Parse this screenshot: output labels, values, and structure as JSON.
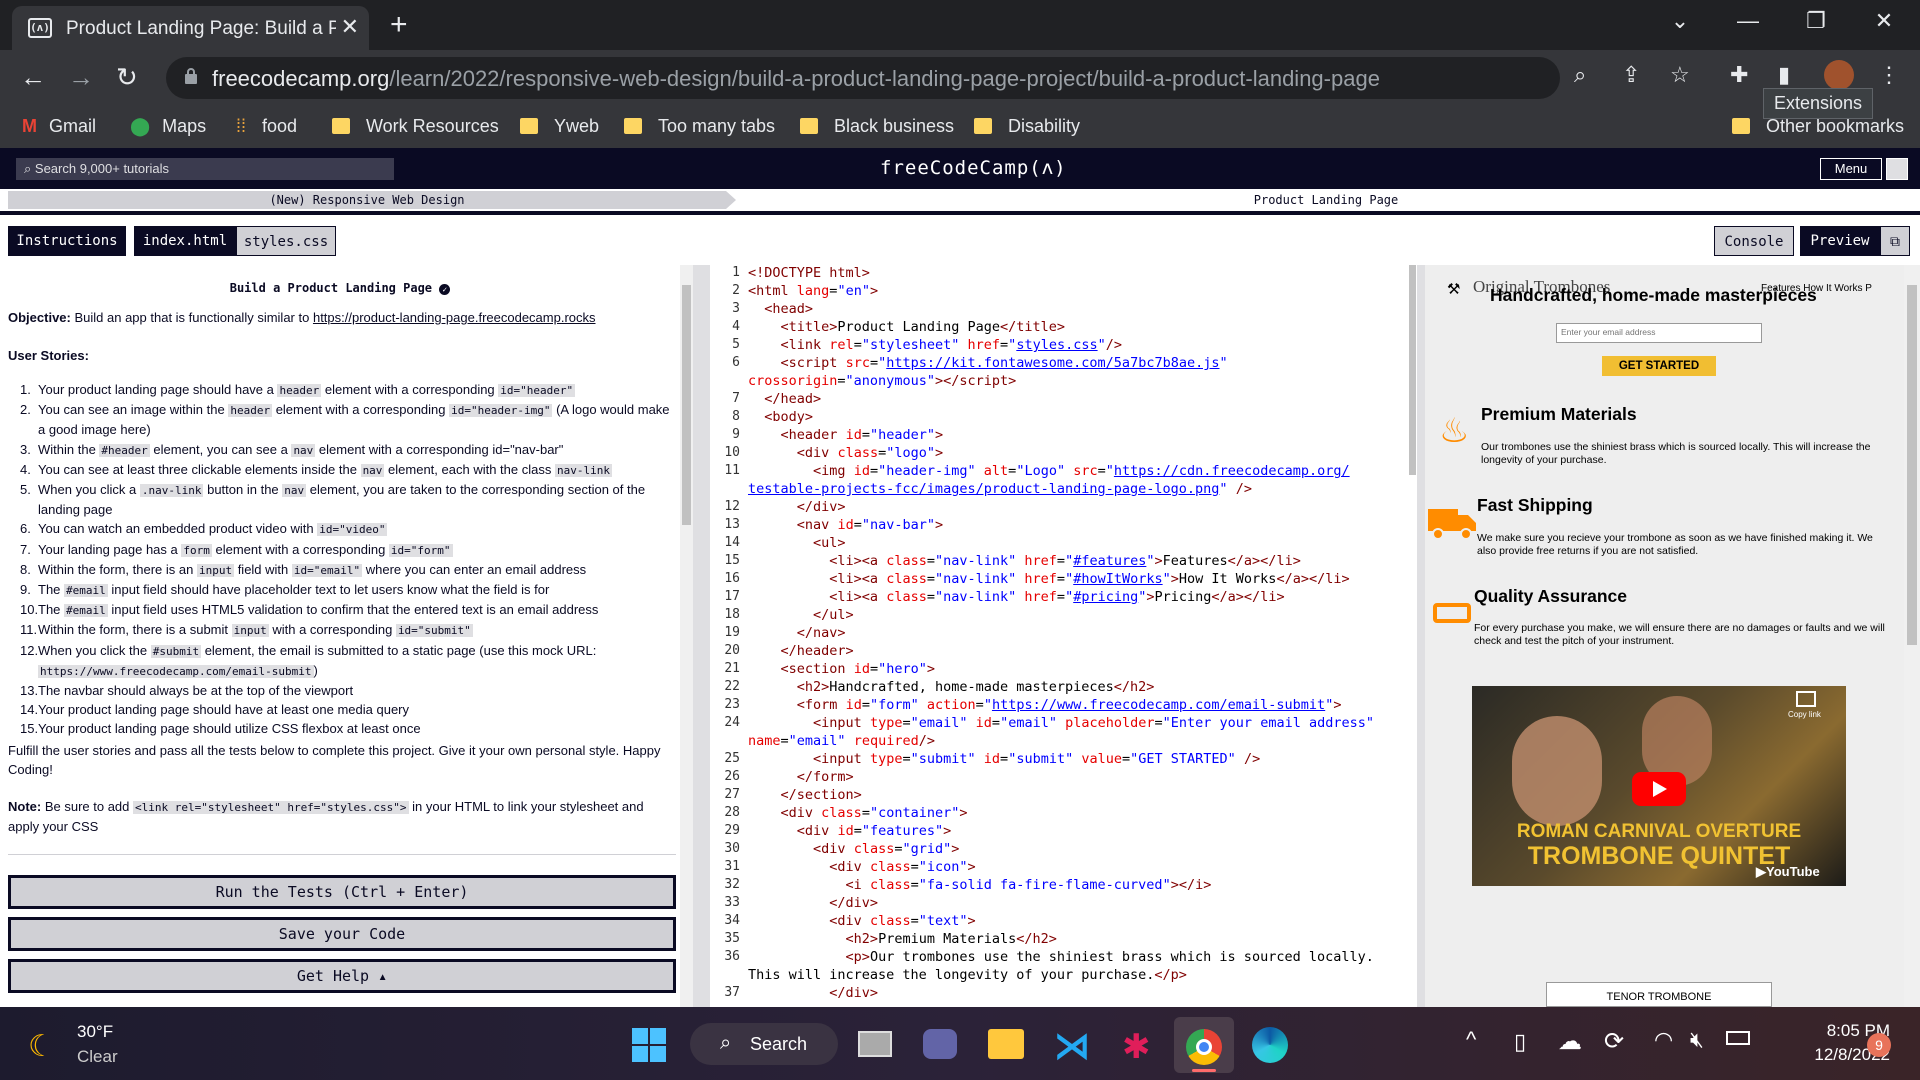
{
  "browser": {
    "tab_title": "Product Landing Page: Build a Product Landing Page",
    "favicon_text": "(ʌ)",
    "url_host": "freecodecamp.org",
    "url_path": "/learn/2022/responsive-web-design/build-a-product-landing-page-project/build-a-product-landing-page",
    "tooltip": "Extensions",
    "bookmarks": [
      "Gmail",
      "Maps",
      "food",
      "Work Resources",
      "Yweb",
      "Too many tabs",
      "Black business",
      "Disability",
      "Other bookmarks"
    ]
  },
  "fcc": {
    "search_placeholder": "Search 9,000+ tutorials",
    "logo": "freeCodeCamp(ʌ)",
    "menu": "Menu",
    "breadcrumb_course": "(New) Responsive Web Design",
    "breadcrumb_project": "Product Landing Page",
    "tabs": {
      "instructions": "Instructions",
      "index": "index.html",
      "styles": "styles.css",
      "console": "Console",
      "preview": "Preview"
    }
  },
  "instructions": {
    "title": "Build a Product Landing Page",
    "objective_label": "Objective:",
    "objective_text": "Build an app that is functionally similar to",
    "objective_link": "https://product-landing-page.freecodecamp.rocks",
    "stories_label": "User Stories:",
    "stories": [
      [
        "Your product landing page should have a ",
        "header",
        " element with a corresponding ",
        "id=\"header\"",
        ""
      ],
      [
        "You can see an image within the ",
        "header",
        " element with a corresponding ",
        "id=\"header-img\"",
        " (A logo would make a good image here)"
      ],
      [
        "Within the ",
        "#header",
        " element, you can see a ",
        "nav",
        " element with a corresponding id=\"nav-bar\""
      ],
      [
        "You can see at least three clickable elements inside the ",
        "nav",
        " element, each with the class ",
        "nav-link",
        ""
      ],
      [
        "When you click a ",
        ".nav-link",
        " button in the ",
        "nav",
        " element, you are taken to the corresponding section of the landing page"
      ],
      [
        "You can watch an embedded product video with ",
        "id=\"video\"",
        "",
        "",
        ""
      ],
      [
        "Your landing page has a ",
        "form",
        " element with a corresponding ",
        "id=\"form\"",
        ""
      ],
      [
        "Within the form, there is an ",
        "input",
        " field with ",
        "id=\"email\"",
        " where you can enter an email address"
      ],
      [
        "The ",
        "#email",
        " input field should have placeholder text to let users know what the field is for",
        "",
        ""
      ],
      [
        "The ",
        "#email",
        " input field uses HTML5 validation to confirm that the entered text is an email address",
        "",
        ""
      ],
      [
        "Within the form, there is a submit ",
        "input",
        " with a corresponding ",
        "id=\"submit\"",
        ""
      ],
      [
        "When you click the ",
        "#submit",
        " element, the email is submitted to a static page (use this mock URL: ",
        "https://www.freecodecamp.com/email-submit",
        ")"
      ],
      [
        "The navbar should always be at the top of the viewport",
        "",
        "",
        "",
        ""
      ],
      [
        "Your product landing page should have at least one media query",
        "",
        "",
        "",
        ""
      ],
      [
        "Your product landing page should utilize CSS flexbox at least once",
        "",
        "",
        "",
        ""
      ]
    ],
    "fulfill": "Fulfill the user stories and pass all the tests below to complete this project. Give it your own personal style. Happy Coding!",
    "note_label": "Note:",
    "note_pre": " Be sure to add ",
    "note_code": "<link rel=\"stylesheet\" href=\"styles.css\">",
    "note_post": " in your HTML to link your stylesheet and apply your CSS",
    "run_tests": "Run the Tests (Ctrl + Enter)",
    "save_code": "Save your Code",
    "get_help": "Get Help ▴"
  },
  "editor": {
    "line_numbers": [
      "1",
      "2",
      "3",
      "4",
      "5",
      "6",
      "",
      "7",
      "8",
      "9",
      "10",
      "11",
      "",
      "12",
      "13",
      "14",
      "15",
      "16",
      "17",
      "18",
      "19",
      "20",
      "21",
      "22",
      "23",
      "24",
      "",
      "25",
      "26",
      "27",
      "28",
      "29",
      "30",
      "31",
      "32",
      "33",
      "34",
      "35",
      "36",
      "",
      "37"
    ]
  },
  "preview": {
    "logo_text": "Original Trombones",
    "nav_links": "Features How It Works P",
    "hero_title": "Handcrafted, home-made masterpieces",
    "email_placeholder": "Enter your email address",
    "get_started": "GET STARTED",
    "features": [
      {
        "title": "Premium Materials",
        "text": "Our trombones use the shiniest brass which is sourced locally. This will increase the longevity of your purchase."
      },
      {
        "title": "Fast Shipping",
        "text": "We make sure you recieve your trombone as soon as we have finished making it. We also provide free returns if you are not satisfied."
      },
      {
        "title": "Quality Assurance",
        "text": "For every purchase you make, we will ensure there are no damages or faults and we will check and test the pitch of your instrument."
      }
    ],
    "video_line1": "ROMAN CARNIVAL OVERTURE",
    "video_line2": "TROMBONE QUINTET",
    "video_copy": "Copy link",
    "video_yt": "YouTube",
    "tenor": "TENOR TROMBONE"
  },
  "taskbar": {
    "temp": "30°F",
    "weather": "Clear",
    "search": "Search",
    "time": "8:05 PM",
    "date": "12/8/2022",
    "badge": "9"
  }
}
